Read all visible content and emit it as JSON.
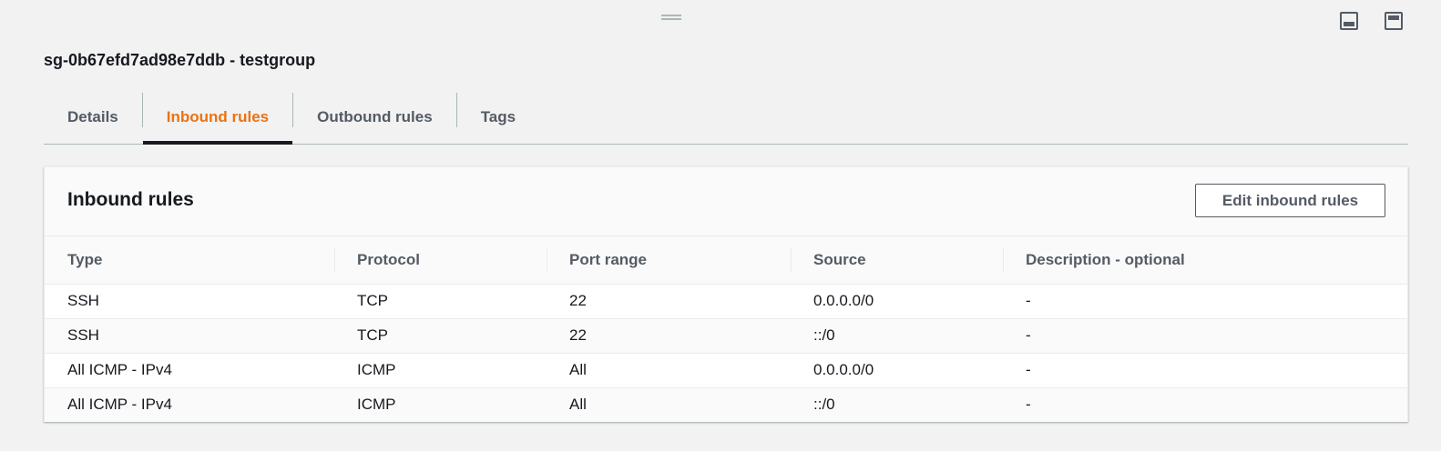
{
  "page": {
    "title": "sg-0b67efd7ad98e7ddb - testgroup"
  },
  "tabs": [
    {
      "label": "Details",
      "active": false
    },
    {
      "label": "Inbound rules",
      "active": true
    },
    {
      "label": "Outbound rules",
      "active": false
    },
    {
      "label": "Tags",
      "active": false
    }
  ],
  "inbound": {
    "title": "Inbound rules",
    "edit_label": "Edit inbound rules",
    "columns": [
      "Type",
      "Protocol",
      "Port range",
      "Source",
      "Description - optional"
    ],
    "rows": [
      [
        "SSH",
        "TCP",
        "22",
        "0.0.0.0/0",
        "-"
      ],
      [
        "SSH",
        "TCP",
        "22",
        "::/0",
        "-"
      ],
      [
        "All ICMP - IPv4",
        "ICMP",
        "All",
        "0.0.0.0/0",
        "-"
      ],
      [
        "All ICMP - IPv4",
        "ICMP",
        "All",
        "::/0",
        "-"
      ]
    ]
  },
  "colors": {
    "accent": "#ec7211",
    "text": "#16191f",
    "muted": "#545b64",
    "border": "#eaeded"
  },
  "icons": {
    "drag": "drag-handle-icon",
    "panel_bottom": "panel-bottom-icon",
    "panel_side": "panel-side-icon"
  }
}
